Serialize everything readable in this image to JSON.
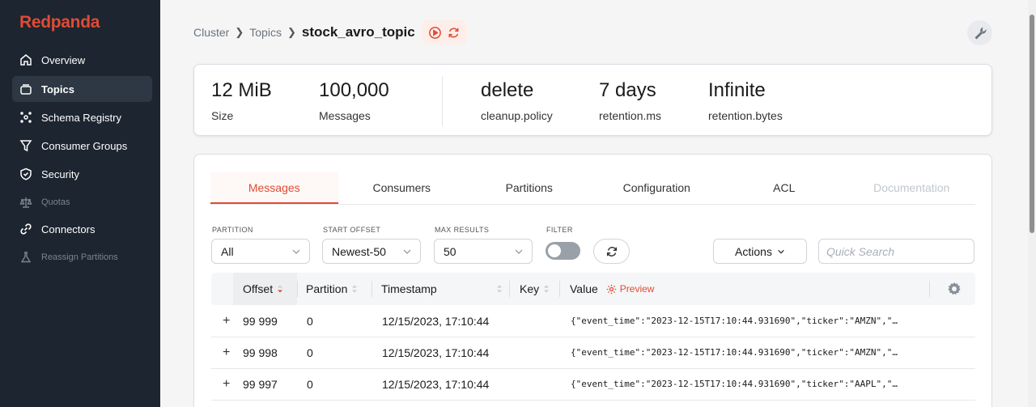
{
  "app": {
    "logo": "Redpanda"
  },
  "sidebar": {
    "items": [
      {
        "label": "Overview",
        "icon": "home-icon"
      },
      {
        "label": "Topics",
        "icon": "topics-icon",
        "active": true
      },
      {
        "label": "Schema Registry",
        "icon": "schema-icon"
      },
      {
        "label": "Consumer Groups",
        "icon": "filter-icon"
      },
      {
        "label": "Security",
        "icon": "shield-icon"
      },
      {
        "label": "Quotas",
        "icon": "scale-icon",
        "disabled": true
      },
      {
        "label": "Connectors",
        "icon": "link-icon"
      },
      {
        "label": "Reassign Partitions",
        "icon": "flask-icon",
        "disabled": true
      }
    ]
  },
  "breadcrumb": {
    "cluster": "Cluster",
    "topics": "Topics",
    "current": "stock_avro_topic"
  },
  "stats": [
    {
      "value": "12 MiB",
      "label": "Size"
    },
    {
      "value": "100,000",
      "label": "Messages"
    },
    {
      "value": "delete",
      "label": "cleanup.policy"
    },
    {
      "value": "7 days",
      "label": "retention.ms"
    },
    {
      "value": "Infinite",
      "label": "retention.bytes"
    }
  ],
  "tabs": [
    "Messages",
    "Consumers",
    "Partitions",
    "Configuration",
    "ACL",
    "Documentation"
  ],
  "filters": {
    "partition": {
      "label": "PARTITION",
      "value": "All"
    },
    "start_offset": {
      "label": "START OFFSET",
      "value": "Newest-50"
    },
    "max_results": {
      "label": "MAX RESULTS",
      "value": "50"
    },
    "filter": {
      "label": "FILTER",
      "enabled": false
    },
    "actions_label": "Actions",
    "search_placeholder": "Quick Search"
  },
  "table": {
    "columns": {
      "offset": "Offset",
      "partition": "Partition",
      "timestamp": "Timestamp",
      "key": "Key",
      "value": "Value",
      "preview": "Preview"
    },
    "rows": [
      {
        "offset": "99 999",
        "partition": "0",
        "timestamp": "12/15/2023, 17:10:44",
        "value": "{\"event_time\":\"2023-12-15T17:10:44.931690\",\"ticker\":\"AMZN\",\"…"
      },
      {
        "offset": "99 998",
        "partition": "0",
        "timestamp": "12/15/2023, 17:10:44",
        "value": "{\"event_time\":\"2023-12-15T17:10:44.931690\",\"ticker\":\"AMZN\",\"…"
      },
      {
        "offset": "99 997",
        "partition": "0",
        "timestamp": "12/15/2023, 17:10:44",
        "value": "{\"event_time\":\"2023-12-15T17:10:44.931690\",\"ticker\":\"AAPL\",\"…"
      }
    ]
  },
  "colors": {
    "accent": "#e14b34",
    "sidebar_bg": "#1c2530"
  }
}
